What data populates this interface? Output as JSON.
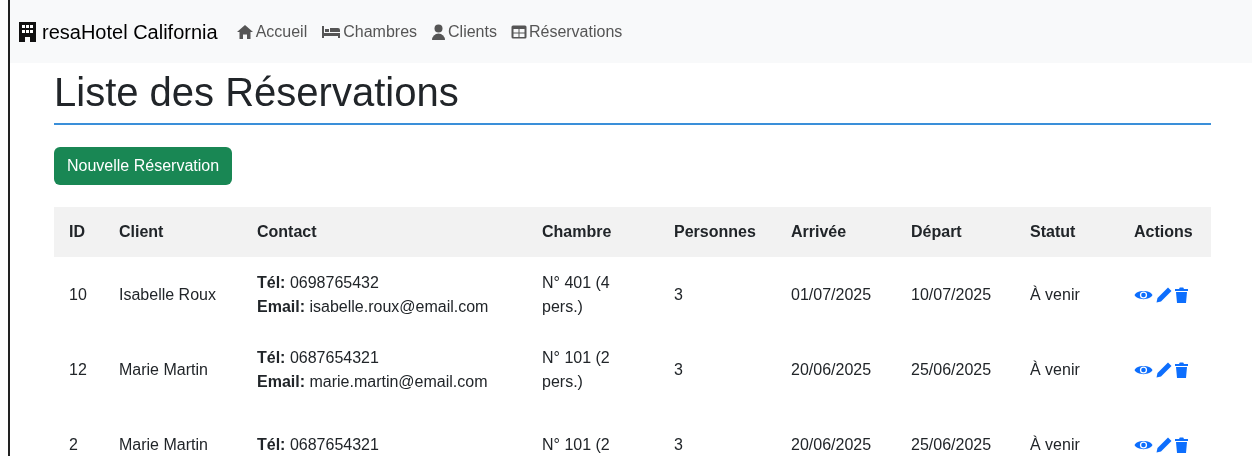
{
  "navbar": {
    "brand": "resaHotel California",
    "links": [
      "Accueil",
      "Chambres",
      "Clients",
      "Réservations"
    ]
  },
  "title": "Liste des Réservations",
  "new_button": "Nouvelle Réservation",
  "table": {
    "columns": [
      "ID",
      "Client",
      "Contact",
      "Chambre",
      "Personnes",
      "Arrivée",
      "Départ",
      "Statut",
      "Actions"
    ],
    "rows": [
      {
        "id": "10",
        "client": "Isabelle Roux",
        "phone_label": "Tél:",
        "phone": "0698765432",
        "email_label": "Email:",
        "email": "isabelle.roux@email.com",
        "room": "N° 401 (4 pers.)",
        "persons": "3",
        "arrival": "01/07/2025",
        "departure": "10/07/2025",
        "status": "À venir"
      },
      {
        "id": "12",
        "client": "Marie Martin",
        "phone_label": "Tél:",
        "phone": "0687654321",
        "email_label": "Email:",
        "email": "marie.martin@email.com",
        "room": "N° 101 (2 pers.)",
        "persons": "3",
        "arrival": "20/06/2025",
        "departure": "25/06/2025",
        "status": "À venir"
      },
      {
        "id": "2",
        "client": "Marie Martin",
        "phone_label": "Tél:",
        "phone": "0687654321",
        "room": "N° 101 (2",
        "persons": "3",
        "arrival": "20/06/2025",
        "departure": "25/06/2025",
        "status": "À venir"
      }
    ]
  }
}
